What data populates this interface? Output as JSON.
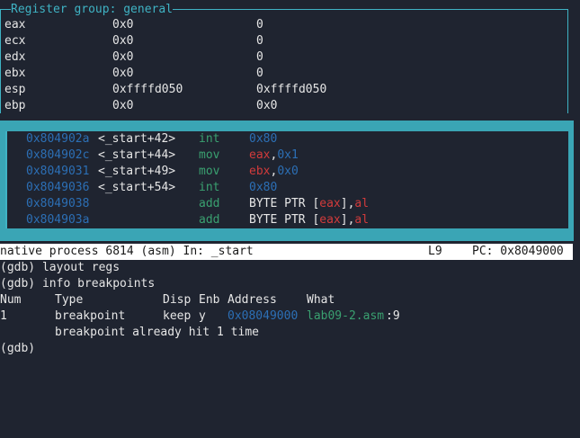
{
  "registers": {
    "title": "Register group: general",
    "rows": [
      {
        "name": "eax",
        "hex": "0x0",
        "natural": "0"
      },
      {
        "name": "ecx",
        "hex": "0x0",
        "natural": "0"
      },
      {
        "name": "edx",
        "hex": "0x0",
        "natural": "0"
      },
      {
        "name": "ebx",
        "hex": "0x0",
        "natural": "0"
      },
      {
        "name": "esp",
        "hex": "0xffffd050",
        "natural": "0xffffd050"
      },
      {
        "name": "ebp",
        "hex": "0x0",
        "natural": "0x0"
      }
    ]
  },
  "asm": {
    "rows": [
      {
        "addr": "0x804902a",
        "label": "<_start+42>",
        "mnem": "int",
        "ops": [
          {
            "t": "0x80",
            "c": "num"
          }
        ]
      },
      {
        "addr": "0x804902c",
        "label": "<_start+44>",
        "mnem": "mov",
        "ops": [
          {
            "t": "eax",
            "c": "reg"
          },
          {
            "t": ",",
            "c": "plain"
          },
          {
            "t": "0x1",
            "c": "num"
          }
        ]
      },
      {
        "addr": "0x8049031",
        "label": "<_start+49>",
        "mnem": "mov",
        "ops": [
          {
            "t": "ebx",
            "c": "reg"
          },
          {
            "t": ",",
            "c": "plain"
          },
          {
            "t": "0x0",
            "c": "num"
          }
        ]
      },
      {
        "addr": "0x8049036",
        "label": "<_start+54>",
        "mnem": "int",
        "ops": [
          {
            "t": "0x80",
            "c": "num"
          }
        ]
      },
      {
        "addr": "0x8049038",
        "label": "",
        "mnem": "add",
        "ops": [
          {
            "t": "BYTE PTR [",
            "c": "plain"
          },
          {
            "t": "eax",
            "c": "reg"
          },
          {
            "t": "],",
            "c": "plain"
          },
          {
            "t": "al",
            "c": "reg"
          }
        ]
      },
      {
        "addr": "0x804903a",
        "label": "",
        "mnem": "add",
        "ops": [
          {
            "t": "BYTE PTR [",
            "c": "plain"
          },
          {
            "t": "eax",
            "c": "reg"
          },
          {
            "t": "],",
            "c": "plain"
          },
          {
            "t": "al",
            "c": "reg"
          }
        ]
      }
    ]
  },
  "status": {
    "left": "native process 6814 (asm) In: _start",
    "line": "L9",
    "pc": "PC: 0x8049000"
  },
  "console": {
    "cmd1": "(gdb) layout regs",
    "cmd2": "(gdb) info breakpoints",
    "headers": {
      "num": "Num",
      "type": "Type",
      "disp": "Disp",
      "enb": "Enb",
      "address": "Address",
      "what": "What"
    },
    "bp": {
      "num": "1",
      "type": "breakpoint",
      "disp": "keep",
      "enb": "y",
      "address": "0x08049000",
      "file": "lab09-2.asm",
      "line": ":9"
    },
    "hit": "breakpoint already hit 1 time",
    "prompt": "(gdb)"
  }
}
